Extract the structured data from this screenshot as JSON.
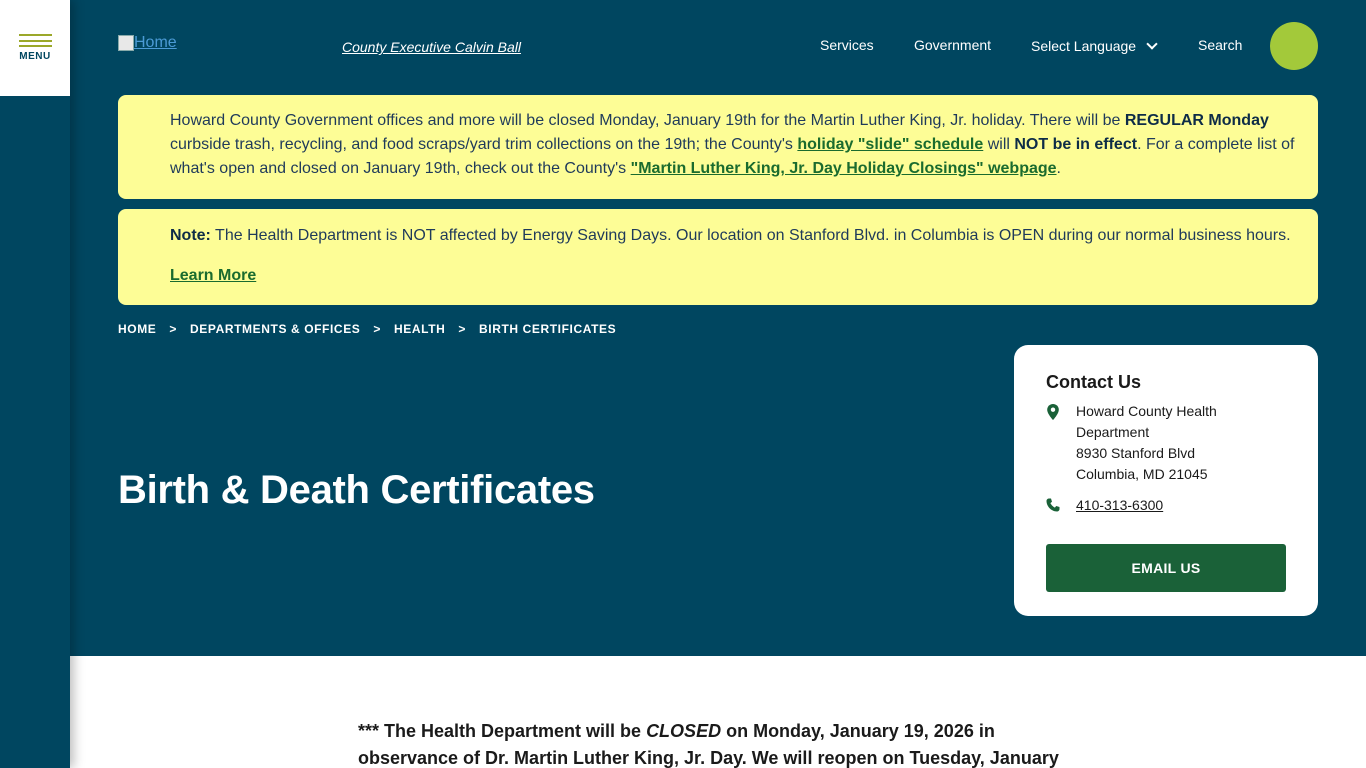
{
  "menu": {
    "label": "MENU"
  },
  "header": {
    "logo_alt": "Home",
    "exec_link": "County Executive Calvin Ball",
    "nav_services": "Services",
    "nav_government": "Government",
    "nav_language": "Select Language",
    "nav_search": "Search"
  },
  "alert1": {
    "t1": "Howard County Government offices and more will be closed Monday, January 19th for the Martin Luther King, Jr. holiday. There will be ",
    "b1": "REGULAR Monday",
    "t2": " curbside trash, recycling, and food scraps/yard trim collections on the 19th; the County's ",
    "link1": "holiday \"slide\" schedule",
    "t3": " will ",
    "b2": "NOT be in effect",
    "t4": ". For a complete list of what's open and closed on January 19th, check out the County's ",
    "link2": "\"Martin Luther King, Jr. Day Holiday Closings\" webpage",
    "t5": "."
  },
  "alert2": {
    "note_label": "Note:",
    "text": " The Health Department is NOT affected by Energy Saving Days. Our location on Stanford Blvd. in Columbia is OPEN during our normal business hours.",
    "learn_more": "Learn More"
  },
  "breadcrumb": [
    "HOME",
    "DEPARTMENTS & OFFICES",
    "HEALTH",
    "BIRTH CERTIFICATES"
  ],
  "breadcrumb_sep": ">",
  "page_title": "Birth & Death Certificates",
  "contact": {
    "heading": "Contact Us",
    "address_line1": "Howard County Health",
    "address_line2": "Department",
    "address_line3": "8930 Stanford Blvd",
    "address_line4": "Columbia, MD 21045",
    "phone": "410-313-6300",
    "email_button": "EMAIL US"
  },
  "notice": {
    "prefix": "*** The Health Department will be ",
    "closed": "CLOSED",
    "rest": " on Monday, January 19, 2026 in observance of Dr. Martin Luther King, Jr. Day. We will reopen on Tuesday, January"
  },
  "colors": {
    "brand_teal": "#004660",
    "alert_yellow": "#fdfd96",
    "accent_green": "#1a6138",
    "lime": "#a3c93a"
  }
}
